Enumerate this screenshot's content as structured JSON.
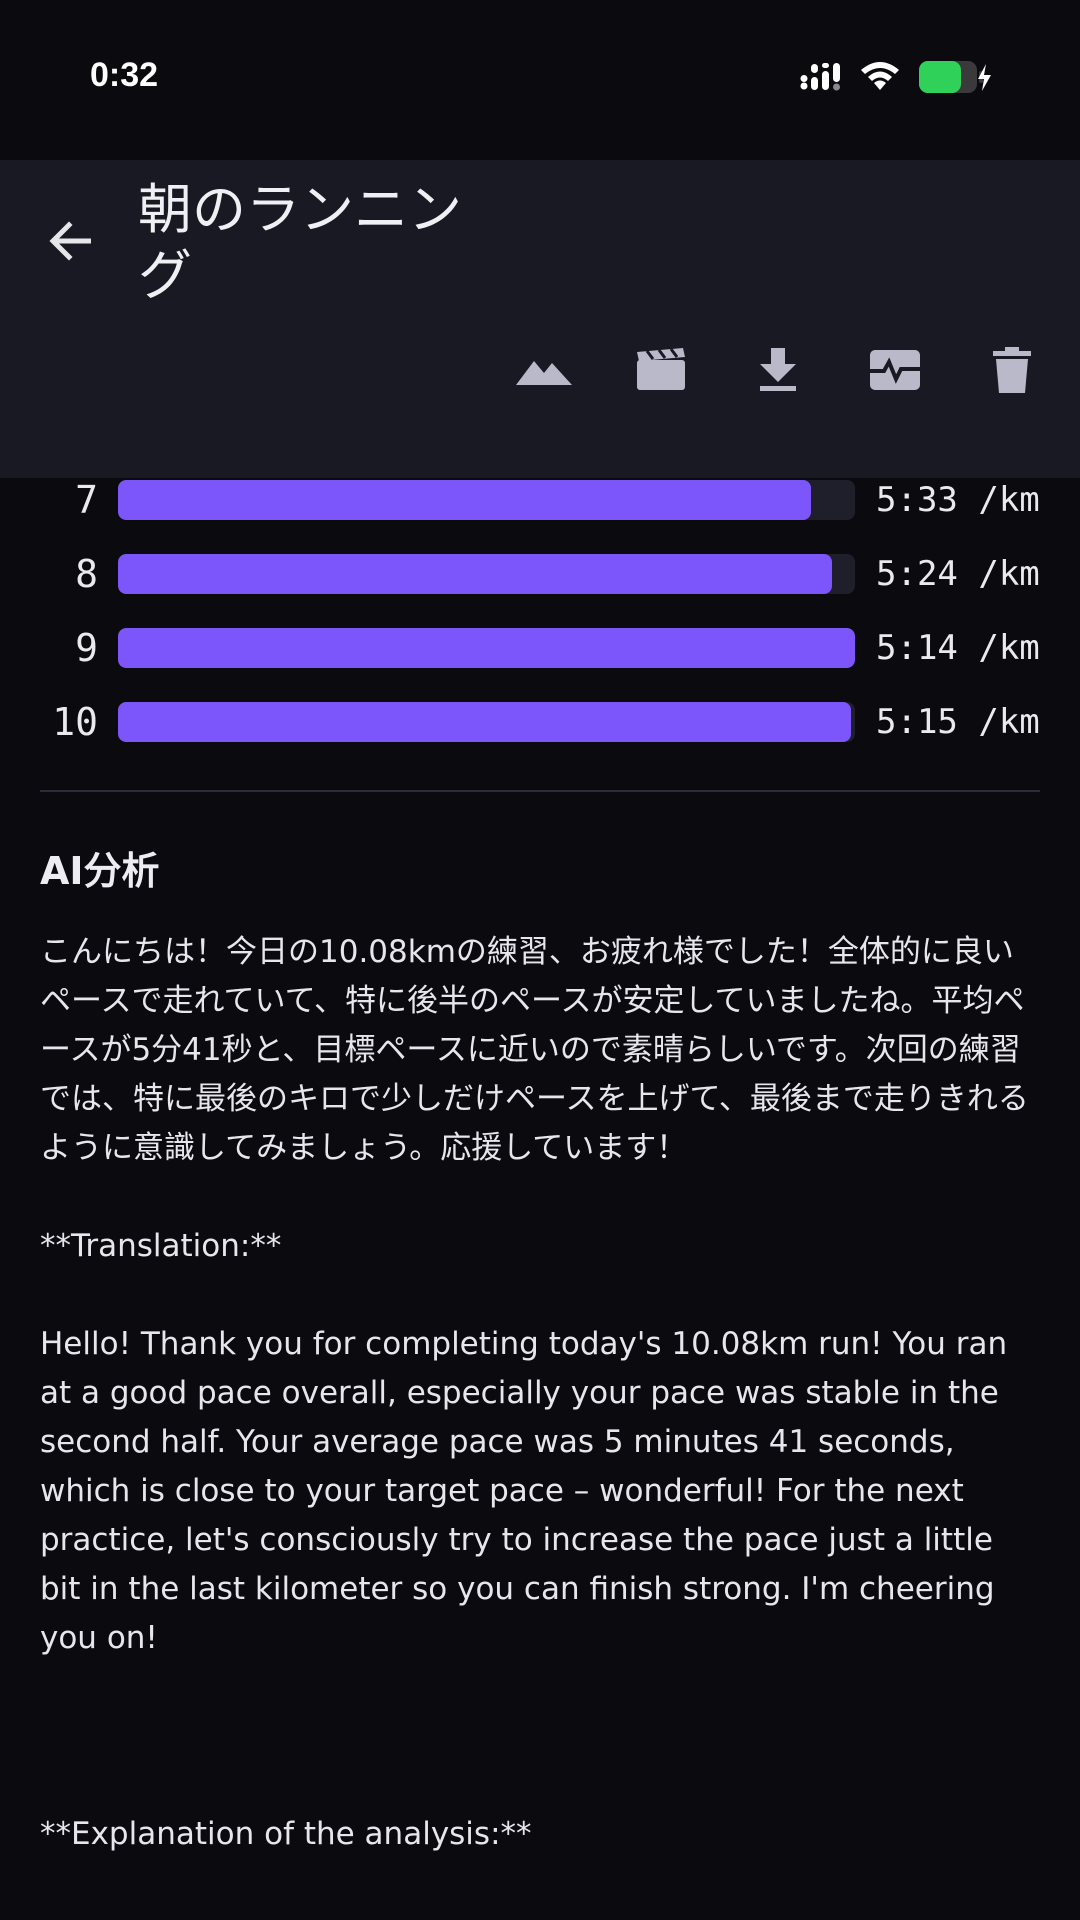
{
  "status": {
    "time": "0:32"
  },
  "app_bar": {
    "title": "朝のランニング",
    "back_icon": "arrow-left-icon",
    "actions": [
      {
        "name": "terrain-icon"
      },
      {
        "name": "movie-icon"
      },
      {
        "name": "download-icon"
      },
      {
        "name": "monitor-heart-icon"
      },
      {
        "name": "delete-icon"
      }
    ]
  },
  "laps": [
    {
      "num": "7",
      "pace": "5:33 /km",
      "fill": 0.94
    },
    {
      "num": "8",
      "pace": "5:24 /km",
      "fill": 0.969
    },
    {
      "num": "9",
      "pace": "5:14 /km",
      "fill": 1.0
    },
    {
      "num": "10",
      "pace": "5:15 /km",
      "fill": 0.995
    }
  ],
  "ai": {
    "title": "AI分析",
    "paragraph_ja": "こんにちは！今日の10.08kmの練習、お疲れ様でした！全体的に良いペースで走れていて、特に後半のペースが安定していましたね。平均ペースが5分41秒と、目標ペースに近いので素晴らしいです。次回の練習では、特に最後のキロで少しだけペースを上げて、最後まで走りきれるように意識してみましょう。応援しています！",
    "translation_heading": "**Translation:**",
    "paragraph_en": "Hello! Thank you for completing today's 10.08km run! You ran at a good pace overall, especially your pace was stable in the second half. Your average pace was 5 minutes 41 seconds, which is close to your target pace – wonderful! For the next practice, let's consciously try to increase the pace just a little bit in the last kilometer so you can finish strong. I'm cheering you on!",
    "explanation_heading": "**Explanation of the analysis:**"
  },
  "colors": {
    "bar_fill": "#7c55fb",
    "bar_track": "#1e1f2a",
    "background": "#0b0b0f",
    "app_bar": "#181922",
    "battery": "#30d158"
  }
}
